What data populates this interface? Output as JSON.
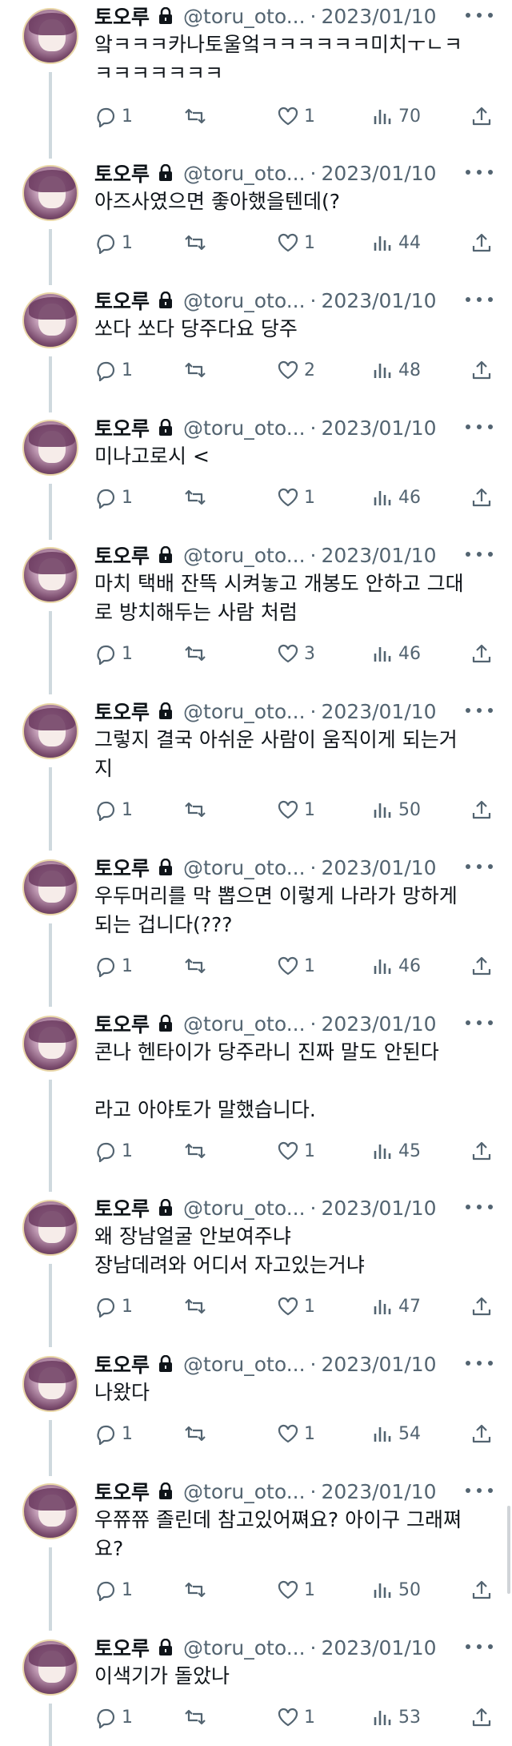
{
  "tweets": [
    {
      "name": "토오루",
      "handle": "@toru_oto...",
      "date": "2023/01/10",
      "text": "앜ㅋㅋㅋ카나토울엌ㅋㅋㅋㅋㅋㅋ미치ㅜㄴㅋ\nㅋㅋㅋㅋㅋㅋㅋ",
      "replies": "1",
      "likes": "1",
      "views": "70"
    },
    {
      "name": "토오루",
      "handle": "@toru_oto...",
      "date": "2023/01/10",
      "text": "아즈사였으면 좋아했을텐데(?",
      "replies": "1",
      "likes": "1",
      "views": "44"
    },
    {
      "name": "토오루",
      "handle": "@toru_oto...",
      "date": "2023/01/10",
      "text": "쏘다 쏘다 당주다요 당주",
      "replies": "1",
      "likes": "2",
      "views": "48"
    },
    {
      "name": "토오루",
      "handle": "@toru_oto...",
      "date": "2023/01/10",
      "text": "미나고로시 <",
      "replies": "1",
      "likes": "1",
      "views": "46"
    },
    {
      "name": "토오루",
      "handle": "@toru_oto...",
      "date": "2023/01/10",
      "text": "마치 택배 잔뜩 시켜놓고 개봉도 안하고 그대\n로 방치해두는 사람 처럼",
      "replies": "1",
      "likes": "3",
      "views": "46"
    },
    {
      "name": "토오루",
      "handle": "@toru_oto...",
      "date": "2023/01/10",
      "text": "그렇지 결국 아쉬운 사람이 움직이게 되는거\n지",
      "replies": "1",
      "likes": "1",
      "views": "50"
    },
    {
      "name": "토오루",
      "handle": "@toru_oto...",
      "date": "2023/01/10",
      "text": "우두머리를 막 뽑으면 이렇게 나라가 망하게\n되는 겁니다(???",
      "replies": "1",
      "likes": "1",
      "views": "46"
    },
    {
      "name": "토오루",
      "handle": "@toru_oto...",
      "date": "2023/01/10",
      "text": "콘나 헨타이가 당주라니 진짜 말도 안된다\n\n라고 아야토가 말했습니다.",
      "replies": "1",
      "likes": "1",
      "views": "45"
    },
    {
      "name": "토오루",
      "handle": "@toru_oto...",
      "date": "2023/01/10",
      "text": "왜 장남얼굴 안보여주냐\n장남데려와 어디서 자고있는거냐",
      "replies": "1",
      "likes": "1",
      "views": "47"
    },
    {
      "name": "토오루",
      "handle": "@toru_oto...",
      "date": "2023/01/10",
      "text": "나왔다",
      "replies": "1",
      "likes": "1",
      "views": "54"
    },
    {
      "name": "토오루",
      "handle": "@toru_oto...",
      "date": "2023/01/10",
      "text": "우쮸쮸 졸린데 참고있어쪄요? 아이구 그래쪄\n요?",
      "replies": "1",
      "likes": "1",
      "views": "50"
    },
    {
      "name": "토오루",
      "handle": "@toru_oto...",
      "date": "2023/01/10",
      "text": "이색기가 돌았나",
      "replies": "1",
      "likes": "1",
      "views": "53"
    }
  ]
}
